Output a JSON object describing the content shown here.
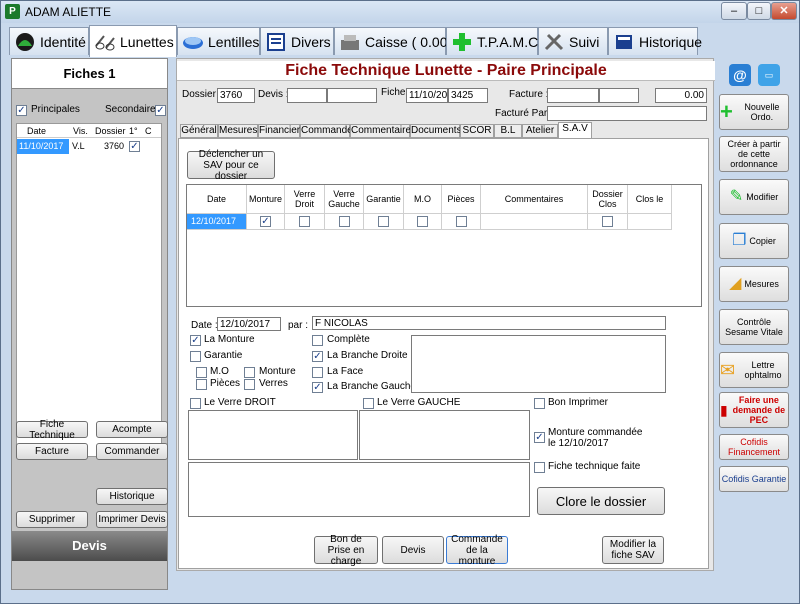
{
  "window": {
    "title": "ADAM ALIETTE",
    "btn_min": "–",
    "btn_max": "□",
    "btn_close": "✕"
  },
  "main_tabs": [
    "Identité",
    "Lunettes",
    "Lentilles",
    "Divers",
    "Caisse ( 0.00)",
    "T.P.A.M.C",
    "Suivi",
    "Historique"
  ],
  "left": {
    "fiches_title": "Fiches 1",
    "principales": "Principales",
    "secondaires": "Secondaires",
    "table_headers": [
      "Date",
      "Vis.",
      "Dossier",
      "1°",
      "C"
    ],
    "row": {
      "date": "11/10/2017",
      "vis": "V.L",
      "dossier": "3760"
    },
    "btn_fiche_technique": "Fiche Technique",
    "btn_acompte": "Acompte",
    "btn_facture": "Facture",
    "btn_commander": "Commander",
    "btn_historique": "Historique",
    "btn_supprimer": "Supprimer",
    "btn_imprimer_devis": "Imprimer Devis",
    "devis": "Devis"
  },
  "header": {
    "title": "Fiche Technique Lunette - Paire Principale",
    "dossier_label": "Dossier :",
    "dossier": "3760",
    "devis_label": "Devis :",
    "fiche_label": "Fiche :",
    "fiche_date": "11/10/2017",
    "fiche_num": "3425",
    "facture_label": "Facture :",
    "amount": "0.00",
    "facture_par_label": "Facturé Par :"
  },
  "sub_tabs": [
    "Général",
    "Mesures",
    "Financier",
    "Commande",
    "Commentaires",
    "Documents",
    "SCOR",
    "B.L",
    "Atelier",
    "S.A.V"
  ],
  "sav": {
    "btn_declencher": "Déclencher un SAV pour ce dossier",
    "grid_headers": [
      "Date",
      "Monture",
      "Verre Droit",
      "Verre Gauche",
      "Garantie",
      "M.O",
      "Pièces",
      "Commentaires",
      "Dossier Clos",
      "Clos le"
    ],
    "row_date": "12/10/2017",
    "date_label": "Date :",
    "date": "12/10/2017",
    "par_label": "par :",
    "par": "F NICOLAS",
    "la_monture": "La Monture",
    "garantie": "Garantie",
    "mo": "M.O",
    "monture": "Monture",
    "pieces": "Pièces",
    "verres": "Verres",
    "complete": "Complète",
    "branche_droite": "La Branche Droite",
    "la_face": "La Face",
    "branche_gauche": "La Branche Gauche",
    "verre_droit": "Le Verre DROIT",
    "verre_gauche": "Le Verre GAUCHE",
    "bon_imprimer": "Bon Imprimer",
    "monture_commandee": "Monture commandée le 12/10/2017",
    "fiche_faite": "Fiche technique faite",
    "btn_clore": "Clore le dossier",
    "btn_bon_prise": "Bon de Prise en charge",
    "btn_devis": "Devis",
    "btn_commande_monture": "Commande de la monture",
    "btn_modifier_sav": "Modifier la fiche SAV"
  },
  "right": {
    "nouvelle_ordo": "Nouvelle Ordo.",
    "creer": "Créer à partir de cette ordonnance",
    "modifier": "Modifier",
    "copier": "Copier",
    "mesures": "Mesures",
    "controle": "Contrôle Sesame Vitale",
    "lettre": "Lettre ophtalmo",
    "faire_pec": "Faire une demande de PEC",
    "cofidis_fin": "Cofidis Financement",
    "cofidis_gar": "Cofidis Garantie"
  },
  "colors": {
    "title_red": "#8b0a0a",
    "select_blue": "#3399ff",
    "pec_red": "#cc0000",
    "cofidis_red": "#cc0000",
    "cofidis_blue": "#1b3f8f"
  }
}
